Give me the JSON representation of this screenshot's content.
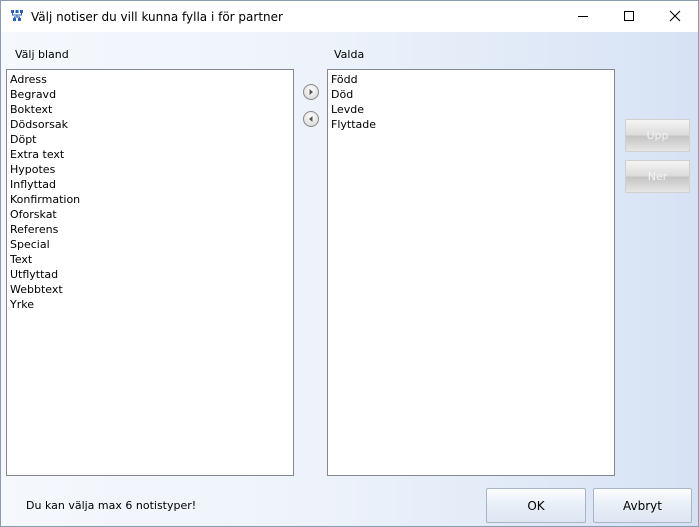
{
  "window": {
    "title": "Välj notiser du vill kunna fylla i för partner"
  },
  "title_bar": {
    "app_icon": "tree-icon",
    "minimize_icon": "minimize-icon",
    "maximize_icon": "maximize-icon",
    "close_icon": "close-icon"
  },
  "available": {
    "label": "Välj bland",
    "items": [
      "Adress",
      "Begravd",
      "Boktext",
      "Dödsorsak",
      "Döpt",
      "Extra text",
      "Hypotes",
      "Inflyttad",
      "Konfirmation",
      "Oforskat",
      "Referens",
      "Special",
      "Text",
      "Utflyttad",
      "Webbtext",
      "Yrke"
    ]
  },
  "selected": {
    "label": "Valda",
    "items": [
      "Född",
      "Död",
      "Levde",
      "Flyttade"
    ]
  },
  "move_buttons": {
    "add_icon": "arrow-right-icon",
    "remove_icon": "arrow-left-icon"
  },
  "order_buttons": {
    "up_label": "Upp",
    "down_label": "Ner"
  },
  "footer": {
    "info_text": "Du kan välja max 6 notistyper!",
    "ok_label": "OK",
    "cancel_label": "Avbryt"
  }
}
